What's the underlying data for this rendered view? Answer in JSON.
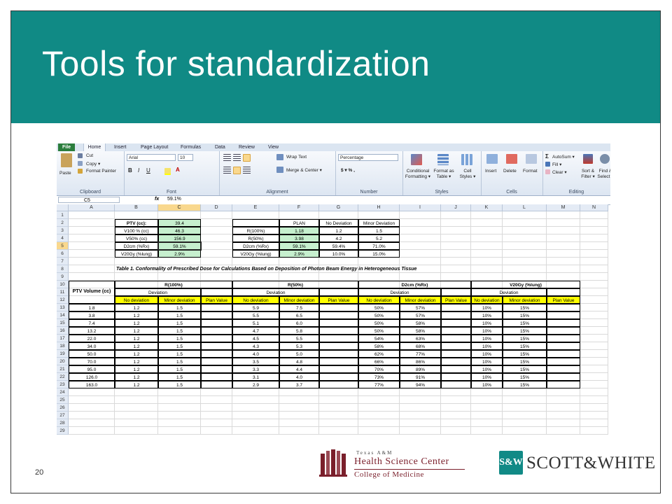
{
  "slide": {
    "title": "Tools for standardization",
    "page_number": "20"
  },
  "excel": {
    "tabs": [
      "File",
      "Home",
      "Insert",
      "Page Layout",
      "Formulas",
      "Data",
      "Review",
      "View"
    ],
    "ribbon": {
      "clipboard": {
        "paste": "Paste",
        "cut": "Cut",
        "copy": "Copy ▾",
        "format_painter": "Format Painter",
        "label": "Clipboard"
      },
      "font": {
        "name": "Arial",
        "size": "10",
        "label": "Font"
      },
      "alignment": {
        "wrap_text": "Wrap Text",
        "merge_center": "Merge & Center ▾",
        "label": "Alignment"
      },
      "number": {
        "format": "Percentage",
        "symbols": "$ ▾  %  ,",
        "label": "Number"
      },
      "styles": {
        "conditional": "Conditional Formatting ▾",
        "format_table": "Format as Table ▾",
        "cell_styles": "Cell Styles ▾",
        "label": "Styles"
      },
      "cells": {
        "insert": "Insert",
        "delete": "Delete",
        "format": "Format",
        "label": "Cells"
      },
      "editing": {
        "autosum": "AutoSum ▾",
        "fill": "Fill ▾",
        "clear": "Clear ▾",
        "sort_filter": "Sort & Filter ▾",
        "find_select": "Find & Select ▾",
        "label": "Editing"
      }
    },
    "formula_bar": {
      "name_box": "C5",
      "fx": "fx",
      "value": "59.1%"
    },
    "columns": [
      "A",
      "B",
      "C",
      "D",
      "E",
      "F",
      "G",
      "H",
      "I",
      "J",
      "K",
      "L",
      "M",
      "N"
    ],
    "rows": [
      "1",
      "2",
      "3",
      "4",
      "5",
      "6",
      "7",
      "8",
      "9",
      "10",
      "11",
      "12",
      "13",
      "14",
      "15",
      "16",
      "17",
      "18",
      "19",
      "20",
      "21",
      "22",
      "23",
      "24",
      "25",
      "26",
      "27",
      "28",
      "29"
    ],
    "summary_left": {
      "labels": [
        "PTV (cc):",
        "V100 % (cc)",
        "V50% (cc)",
        "D2cm (%Rx)",
        "V20Gy (%lung)"
      ],
      "values": [
        "39.4",
        "46.3",
        "156.9",
        "59.1%",
        "2.9%"
      ]
    },
    "summary_right": {
      "headers": [
        "PLAN",
        "No Deviation",
        "Minor Deviation"
      ],
      "rows": [
        [
          "R(100%)",
          "1.18",
          "1.2",
          "1.5"
        ],
        [
          "R(50%)",
          "3.98",
          "4.2",
          "5.2"
        ],
        [
          "D2cm (%Rx)",
          "59.1%",
          "59.4%",
          "71.0%"
        ],
        [
          "V20Gy (%lung)",
          "2.9%",
          "10.0%",
          "15.0%"
        ]
      ]
    },
    "table_caption": "Table 1. Conformality of Prescribed Dose for Calculations Based on Deposition of Photon Beam Energy in Heterogeneous Tissue",
    "table": {
      "ptv_header": "PTV Volume (cc)",
      "groups": [
        "R(100%)",
        "R(50%)",
        "D2cm (%Rx)",
        "V20Gy (%lung)"
      ],
      "deviation": "Deviation",
      "subheaders": [
        "No deviation",
        "Minor deviation",
        "Plan Value"
      ],
      "rows": [
        [
          "1.8",
          "1.2",
          "1.5",
          "5.9",
          "7.5",
          "50%",
          "57%",
          "10%",
          "15%"
        ],
        [
          "3.8",
          "1.2",
          "1.5",
          "5.5",
          "6.5",
          "50%",
          "57%",
          "10%",
          "15%"
        ],
        [
          "7.4",
          "1.2",
          "1.5",
          "5.1",
          "6.0",
          "50%",
          "58%",
          "10%",
          "15%"
        ],
        [
          "13.2",
          "1.2",
          "1.5",
          "4.7",
          "5.8",
          "50%",
          "58%",
          "10%",
          "15%"
        ],
        [
          "22.0",
          "1.2",
          "1.5",
          "4.5",
          "5.5",
          "54%",
          "63%",
          "10%",
          "15%"
        ],
        [
          "34.0",
          "1.2",
          "1.5",
          "4.3",
          "5.3",
          "58%",
          "68%",
          "10%",
          "15%"
        ],
        [
          "50.0",
          "1.2",
          "1.5",
          "4.0",
          "5.0",
          "62%",
          "77%",
          "10%",
          "15%"
        ],
        [
          "70.0",
          "1.2",
          "1.5",
          "3.5",
          "4.8",
          "66%",
          "86%",
          "10%",
          "15%"
        ],
        [
          "95.0",
          "1.2",
          "1.5",
          "3.3",
          "4.4",
          "70%",
          "89%",
          "10%",
          "15%"
        ],
        [
          "126.0",
          "1.2",
          "1.5",
          "3.1",
          "4.0",
          "73%",
          "91%",
          "10%",
          "15%"
        ],
        [
          "163.0",
          "1.2",
          "1.5",
          "2.9",
          "3.7",
          "77%",
          "94%",
          "10%",
          "15%"
        ]
      ]
    }
  },
  "logos": {
    "hsc_small": "Texas A&M",
    "hsc_main": "Health Science Center",
    "hsc_sub": "College of Medicine",
    "sw_mark": "S&W",
    "sw_text": "SCOTT&WHITE"
  },
  "colors": {
    "banner": "#108a85",
    "header_yellow": "#ffff00",
    "plan_green": "#c6efce",
    "hsc_maroon": "#7a1f2b"
  }
}
